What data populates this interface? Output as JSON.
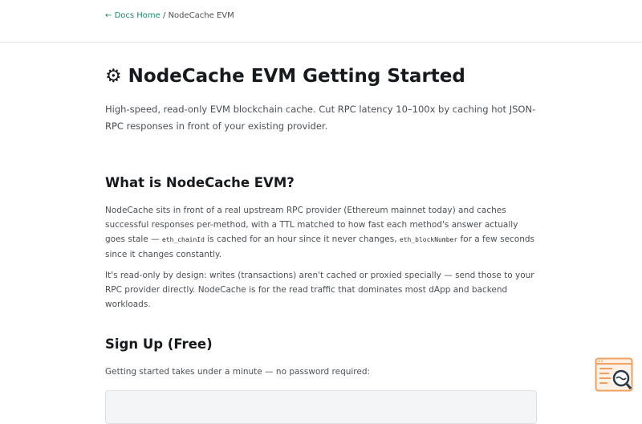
{
  "breadcrumb": {
    "home_arrow": "←",
    "home_label": "Docs Home",
    "separator": "/",
    "current": "NodeCache EVM"
  },
  "hero": {
    "icon": "⚙",
    "title": "NodeCache EVM Getting Started",
    "lede": "High-speed, read-only EVM blockchain cache. Cut RPC latency 10–100x by caching hot JSON-RPC responses in front of your existing provider."
  },
  "section_what": {
    "heading": "What is NodeCache EVM?",
    "p1_before": "NodeCache sits in front of a real upstream RPC provider (Ethereum mainnet today) and caches successful responses per-method, with a TTL matched to how fast each method's answer actually goes stale — ",
    "p1_code1": "eth_chainId",
    "p1_mid": " is cached for an hour since it never changes, ",
    "p1_code2": "eth_blockNumber",
    "p1_after": " for a few seconds since it changes constantly.",
    "p2": "It's read-only by design: writes (transactions) aren't cached or proxied specially — send those to your RPC provider directly. NodeCache is for the read traffic that dominates most dApp and backend workloads."
  },
  "section_signup": {
    "heading": "Sign Up (Free)",
    "intro": "Getting started takes under a minute — no password required:"
  },
  "colors": {
    "link": "#1a8a6e",
    "widget_orange": "#f0a060",
    "widget_dark": "#2a3a4a"
  },
  "widget": {
    "icon": "search-document-icon"
  }
}
